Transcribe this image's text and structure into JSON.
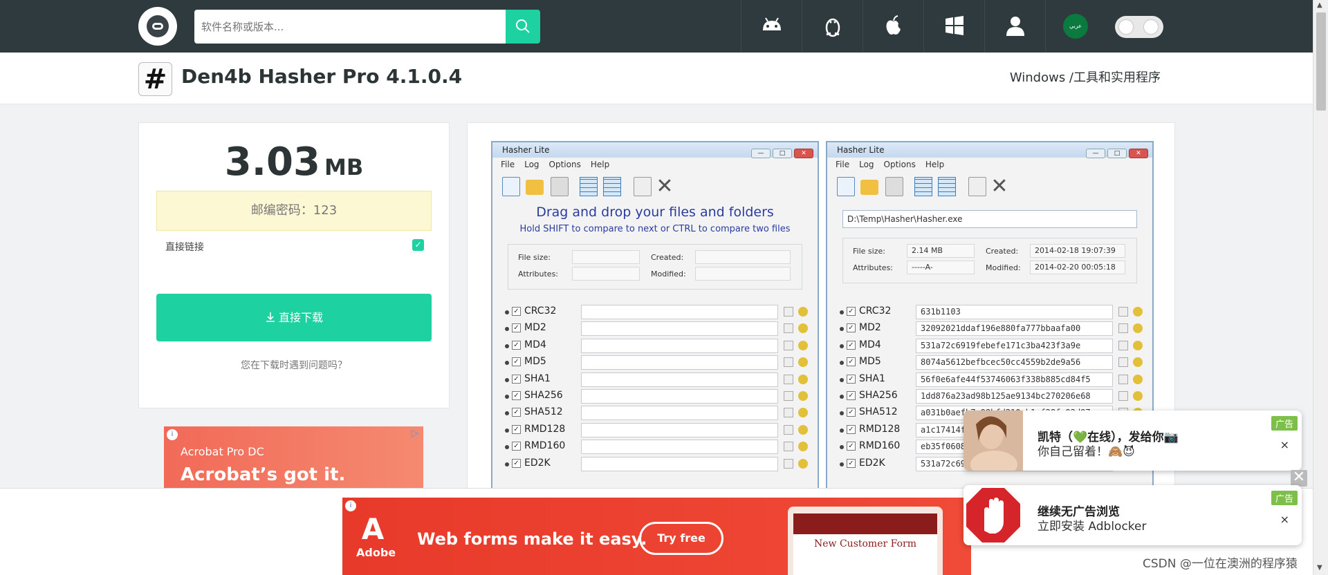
{
  "header": {
    "search_placeholder": "软件名称或版本...",
    "nav_icons": [
      "android-icon",
      "linux-icon",
      "apple-icon",
      "windows-icon",
      "user-icon"
    ],
    "lang_flag_text": "عربي",
    "accent_color": "#1dd1a1",
    "bar_color": "#2f3a3e"
  },
  "app": {
    "icon_glyph": "#",
    "title": "Den4b Hasher Pro 4.1.0.4",
    "breadcrumb": "Windows /工具和实用程序"
  },
  "download": {
    "size_value": "3.03",
    "size_unit": "MB",
    "password": "邮编密码：123",
    "direct_link_label": "直接链接",
    "direct_link_checked": true,
    "download_button": "直接下载",
    "problem_link": "您在下载时遇到问题吗？"
  },
  "ad_acrobat": {
    "brand": "Acrobat Pro DC",
    "tagline": "Acrobat’s got it."
  },
  "screenshot": {
    "window_title": "Hasher Lite",
    "menu": [
      "File",
      "Log",
      "Options",
      "Help"
    ],
    "left": {
      "drag_title": "Drag and drop your files and folders",
      "drag_hint": "Hold SHIFT to compare to next or CTRL to compare two files",
      "file_size_label": "File size:",
      "attributes_label": "Attributes:",
      "created_label": "Created:",
      "modified_label": "Modified:"
    },
    "right": {
      "path": "D:\\Temp\\Hasher\\Hasher.exe",
      "file_size_label": "File size:",
      "file_size": "2.14 MB",
      "attributes_label": "Attributes:",
      "attributes": "-----A-",
      "created_label": "Created:",
      "created": "2014-02-18 19:07:39",
      "modified_label": "Modified:",
      "modified": "2014-02-20 00:05:18"
    },
    "hash_names": [
      "CRC32",
      "MD2",
      "MD4",
      "MD5",
      "SHA1",
      "SHA256",
      "SHA512",
      "RMD128",
      "RMD160",
      "ED2K"
    ],
    "hash_values": [
      "631b1103",
      "32092021ddaf196e880fa777bbaafa00",
      "531a72c6919febefe171c3ba423f3a9e",
      "8074a5612befbcec50cc4559b2de9a56",
      "56f0e6afe44f53746063f338b885cd84f5",
      "1dd876a23ad98b125ae9134bc270206e68",
      "a031b0aefb7c98bfd210cb1cf28fe92d97",
      "a1c17414f5",
      "eb35f06088",
      "531a72c691"
    ]
  },
  "ad_adobe": {
    "logo_text": "Adobe",
    "headline": "Web forms make it easy.",
    "cta": "Try free",
    "form_title": "New Customer Form"
  },
  "popups": [
    {
      "line1": "凯特（💚在线），发给你📷",
      "line2": "你自己留着！🙈😈",
      "badge": "广告",
      "close": "×"
    },
    {
      "line1": "继续无广告浏览",
      "line2": "立即安装 Adblocker",
      "badge": "广告",
      "close": "×"
    }
  ],
  "watermark": "CSDN @一位在澳洲的程序猿"
}
